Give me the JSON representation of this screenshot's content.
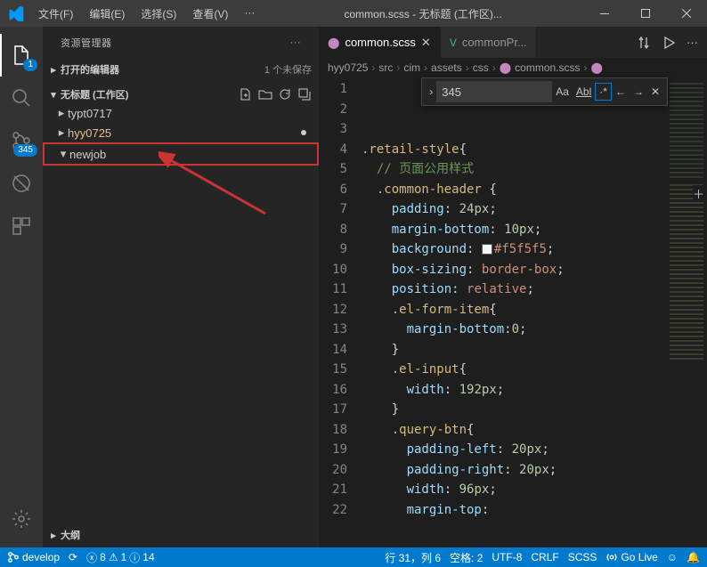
{
  "titlebar": {
    "menus": [
      "文件(F)",
      "编辑(E)",
      "选择(S)",
      "查看(V)",
      "···"
    ],
    "title": "common.scss - 无标题 (工作区)..."
  },
  "activitybar": {
    "explorer_badge": "1",
    "scm_badge": "345"
  },
  "sidebar": {
    "title": "资源管理器",
    "open_editors": {
      "label": "打开的编辑器",
      "hint": "1 个未保存"
    },
    "workspace": {
      "label": "无标题 (工作区)"
    },
    "tree": [
      {
        "name": "typt0717",
        "kind": "folder",
        "state": "collapsed"
      },
      {
        "name": "hyy0725",
        "kind": "folder",
        "state": "collapsed",
        "modified": true
      },
      {
        "name": "newjob",
        "kind": "folder",
        "state": "expanded",
        "highlight": true
      }
    ],
    "outline": {
      "label": "大纲"
    }
  },
  "tabs": [
    {
      "label": "common.scss",
      "icon": "scss",
      "active": true,
      "dirty": true
    },
    {
      "label": "commonPr...",
      "icon": "vue",
      "active": false
    }
  ],
  "breadcrumbs": [
    "hyy0725",
    "src",
    "cim",
    "assets",
    "css",
    "common.scss"
  ],
  "find": {
    "value": "345",
    "match_case": "Aa",
    "whole_word": "Abl",
    "regex": "·*"
  },
  "code": {
    "lines": [
      {
        "n": 1,
        "t": ""
      },
      {
        "n": 2,
        "t": ""
      },
      {
        "n": 3,
        "t": ""
      },
      {
        "n": 4,
        "html": "<span class='c-sel'>.retail-style</span><span class='c-punc'>{</span>"
      },
      {
        "n": 5,
        "html": "  <span class='c-cmt'>// 页面公用样式</span>"
      },
      {
        "n": 6,
        "html": "  <span class='c-sel'>.common-header</span> <span class='c-punc'>{</span>"
      },
      {
        "n": 7,
        "html": "    <span class='c-prop'>padding</span><span class='c-punc'>:</span> <span class='c-num'>24px</span><span class='c-punc'>;</span>"
      },
      {
        "n": 8,
        "html": "    <span class='c-prop'>margin-bottom</span><span class='c-punc'>:</span> <span class='c-num'>10px</span><span class='c-punc'>;</span>"
      },
      {
        "n": 9,
        "html": "    <span class='c-prop'>background</span><span class='c-punc'>:</span> <span class='colorchip'></span><span class='c-val'>#f5f5f5</span><span class='c-punc'>;</span>"
      },
      {
        "n": 10,
        "html": "    <span class='c-prop'>box-sizing</span><span class='c-punc'>:</span> <span class='c-val'>border-box</span><span class='c-punc'>;</span>"
      },
      {
        "n": 11,
        "html": "    <span class='c-prop'>position</span><span class='c-punc'>:</span> <span class='c-val'>relative</span><span class='c-punc'>;</span>"
      },
      {
        "n": 12,
        "html": "    <span class='c-sel'>.el-form-item</span><span class='c-punc'>{</span>"
      },
      {
        "n": 13,
        "html": "      <span class='c-prop'>margin-bottom</span><span class='c-punc'>:</span><span class='c-num'>0</span><span class='c-punc'>;</span>"
      },
      {
        "n": 14,
        "html": "    <span class='c-punc'>}</span>"
      },
      {
        "n": 15,
        "html": "    <span class='c-sel'>.el-input</span><span class='c-punc'>{</span>"
      },
      {
        "n": 16,
        "html": "      <span class='c-prop'>width</span><span class='c-punc'>:</span> <span class='c-num'>192px</span><span class='c-punc'>;</span>"
      },
      {
        "n": 17,
        "html": "    <span class='c-punc'>}</span>"
      },
      {
        "n": 18,
        "html": "    <span class='c-sel'>.query-btn</span><span class='c-punc'>{</span>"
      },
      {
        "n": 19,
        "html": "      <span class='c-prop'>padding-left</span><span class='c-punc'>:</span> <span class='c-num'>20px</span><span class='c-punc'>;</span>"
      },
      {
        "n": 20,
        "html": "      <span class='c-prop'>padding-right</span><span class='c-punc'>:</span> <span class='c-num'>20px</span><span class='c-punc'>;</span>"
      },
      {
        "n": 21,
        "html": "      <span class='c-prop'>width</span><span class='c-punc'>:</span> <span class='c-num'>96px</span><span class='c-punc'>;</span>"
      },
      {
        "n": 22,
        "html": "      <span class='c-prop'>margin-top</span><span class='c-punc'>:</span>"
      }
    ]
  },
  "statusbar": {
    "branch": "develop",
    "sync": "⟳",
    "errors": "8",
    "warnings": "1",
    "infos": "14",
    "cursor": "行 31，列 6",
    "spaces": "空格: 2",
    "encoding": "UTF-8",
    "eol": "CRLF",
    "lang": "SCSS",
    "golive": "Go Live"
  }
}
